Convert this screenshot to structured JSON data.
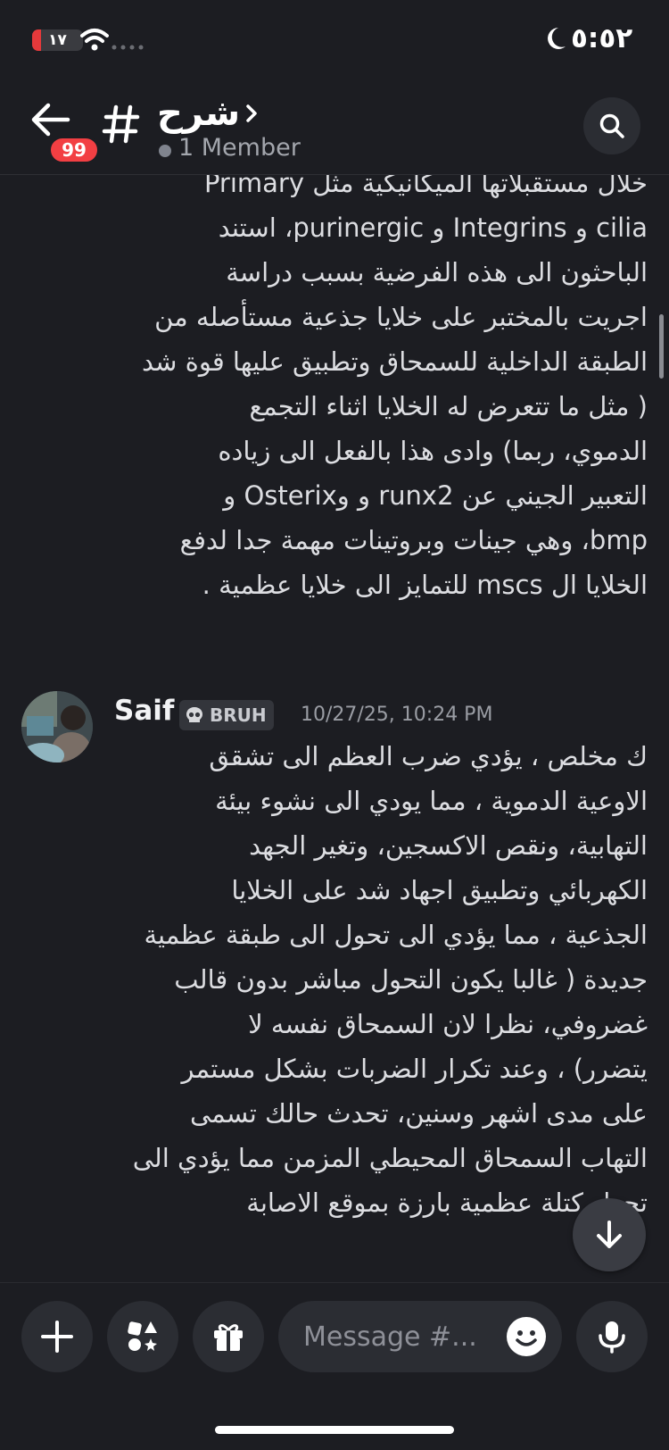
{
  "status_bar": {
    "battery_label": "١٧",
    "battery_level": 0.17,
    "time": "٥:٥٢"
  },
  "header": {
    "unread_badge": "99",
    "channel_name": "شرح",
    "member_count": "1 Member"
  },
  "messages": [
    {
      "lines": [
        "خلال مستقبلاتها الميكانيكية مثل Primary",
        "cilia  و Integrins و purinergic، استند",
        "الباحثون الى هذه الفرضية بسبب دراسة",
        "اجريت بالمختبر على خلايا جذعية مستأصله من",
        "الطبقة الداخلية للسمحاق وتطبيق عليها قوة شد",
        "( مثل ما تتعرض له الخلايا اثناء التجمع",
        "الدموي، ربما) وادى هذا بالفعل الى زياده",
        "التعبير الجيني عن runx2 و وOsterix  و",
        "bmp، وهي جينات وبروتينات مهمة جدا لدفع",
        "الخلايا ال mscs للتمايز الى خلايا عظمية ."
      ]
    },
    {
      "author": "Saif",
      "role_tag": "BRUH",
      "timestamp": "10/27/25, 10:24 PM",
      "lines": [
        "ك مخلص ، يؤدي ضرب العظم الى تشقق",
        "الاوعية الدموية ، مما يودي الى نشوء بيئة",
        "التهابية، ونقص الاكسجين، وتغير الجهد",
        "الكهربائي وتطبيق اجهاد شد على الخلايا",
        "الجذعية ، مما يؤدي الى تحول الى طبقة عظمية",
        "جديدة ( غالبا يكون التحول مباشر بدون قالب",
        "غضروفي، نظرا لان السمحاق نفسه لا",
        "يتضرر) ، وعند تكرار الضربات بشكل مستمر",
        "على مدى اشهر وسنين، تحدث حالك تسمى",
        "التهاب السمحاق المحيطي المزمن مما يؤدي الى",
        "تحول كتلة عظمية بارزة بموقع الاصابة"
      ]
    }
  ],
  "composer": {
    "placeholder": "Message #..."
  },
  "colors": {
    "background": "#1c1d22",
    "surface": "#2b2d33",
    "badge_red": "#f23f43",
    "text_primary": "#dcdde1",
    "text_muted": "#9a9da4"
  },
  "icons": [
    "back-arrow-icon",
    "hash-icon",
    "chevron-right-icon",
    "search-icon",
    "arrow-down-icon",
    "plus-icon",
    "apps-icon",
    "gift-icon",
    "emoji-icon",
    "microphone-icon",
    "wifi-icon",
    "moon-icon",
    "skull-icon"
  ]
}
